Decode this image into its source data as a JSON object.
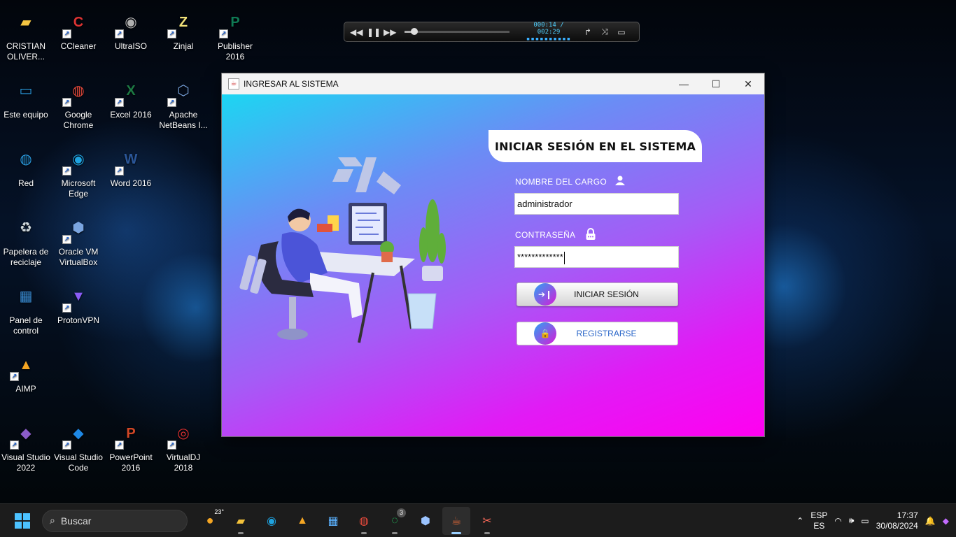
{
  "desktop": {
    "icons": [
      {
        "label": "CRISTIAN OLIVER..."
      },
      {
        "label": "CCleaner"
      },
      {
        "label": "UltraISO"
      },
      {
        "label": "Zinjal"
      },
      {
        "label": "Publisher 2016"
      },
      {
        "label": "Este equipo"
      },
      {
        "label": "Google Chrome"
      },
      {
        "label": "Excel 2016"
      },
      {
        "label": "Apache NetBeans I..."
      },
      {
        "label": "Red"
      },
      {
        "label": "Microsoft Edge"
      },
      {
        "label": "Word 2016"
      },
      {
        "label": "Papelera de reciclaje"
      },
      {
        "label": "Oracle VM VirtualBox"
      },
      {
        "label": "Panel de control"
      },
      {
        "label": "ProtonVPN"
      },
      {
        "label": "AIMP"
      },
      {
        "label": "Visual Studio 2022"
      },
      {
        "label": "Visual Studio Code"
      },
      {
        "label": "PowerPoint 2016"
      },
      {
        "label": "VirtualDJ 2018"
      }
    ]
  },
  "player": {
    "time": "000:14 / 002:29",
    "progress": 0.09
  },
  "window": {
    "title": "INGRESAR AL SISTEMA",
    "heading": "INICIAR SESIÓN EN EL SISTEMA",
    "username_label": "NOMBRE DEL CARGO",
    "username_value": "administrador",
    "password_label": "CONTRASEÑA",
    "password_value": "*************",
    "login_button": "INICIAR SESIÓN",
    "register_button": "REGISTRARSE"
  },
  "taskbar": {
    "search_placeholder": "Buscar",
    "weather": "23°",
    "whatsapp_badge": "3",
    "lang_top": "ESP",
    "lang_bottom": "ES",
    "time": "17:37",
    "date": "30/08/2024"
  }
}
